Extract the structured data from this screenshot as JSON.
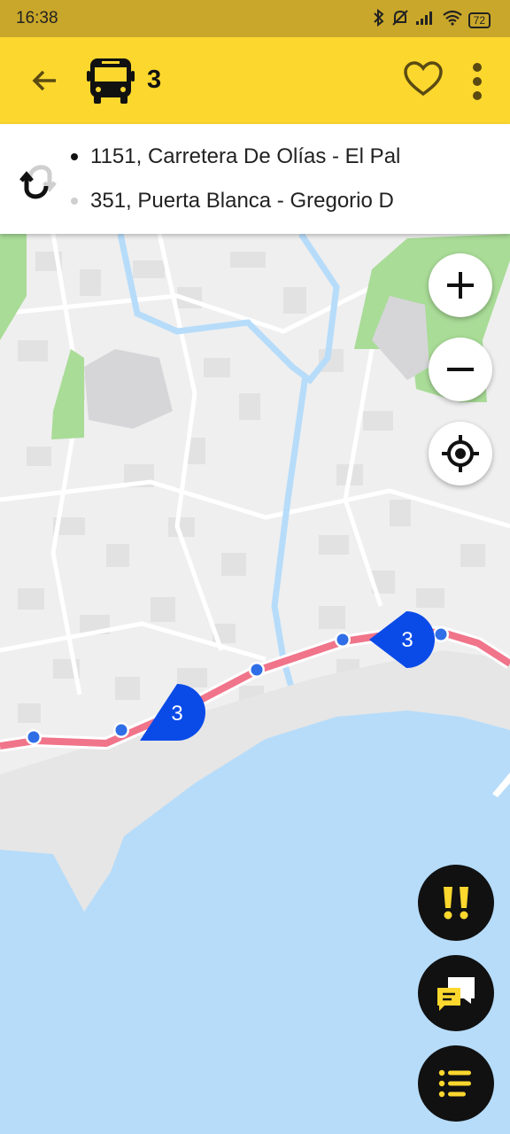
{
  "status_bar": {
    "time": "16:38",
    "battery": "72",
    "icons": [
      "bluetooth-icon",
      "mute-icon",
      "signal-icon",
      "wifi-icon",
      "battery-icon"
    ]
  },
  "header": {
    "line_number": "3",
    "icons": {
      "back": "arrow-left-icon",
      "bus": "bus-icon",
      "favorite": "heart-outline-icon",
      "menu": "more-vertical-icon"
    }
  },
  "route": {
    "stops": [
      {
        "label": "1151, Carretera De Olías - El Pal",
        "active": true
      },
      {
        "label": "351, Puerta Blanca - Gregorio D",
        "active": false
      }
    ]
  },
  "map": {
    "bus_markers": [
      {
        "label": "3"
      },
      {
        "label": "3"
      }
    ],
    "controls": {
      "zoom_in": "plus-icon",
      "zoom_out": "minus-icon",
      "locate": "crosshair-icon"
    }
  },
  "actions": {
    "alerts": "exclamation-icon",
    "messages": "chat-icon",
    "list": "list-icon"
  },
  "colors": {
    "accent": "#fcd72e",
    "route_line": "#f0748a",
    "bus_marker": "#0a4be8",
    "stop_dot": "#2f6ee6",
    "water": "#b6dcfa",
    "park": "#a9dc97"
  }
}
